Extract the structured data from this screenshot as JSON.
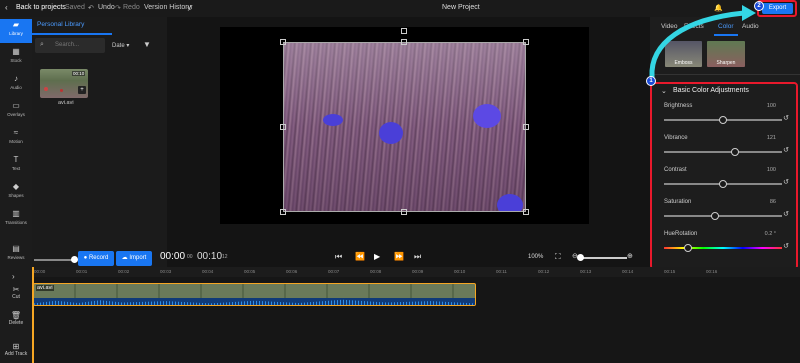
{
  "topbar": {
    "back_label": "Back to projects",
    "saved_label": "Saved",
    "undo_label": "Undo",
    "redo_label": "Redo",
    "history_label": "Version History",
    "title": "New Project",
    "export_label": "Export"
  },
  "rail": {
    "items": [
      {
        "label": "Library",
        "icon": "folder-icon"
      },
      {
        "label": "Stock",
        "icon": "grid-icon"
      },
      {
        "label": "Audio",
        "icon": "music-icon"
      },
      {
        "label": "Overlays",
        "icon": "layers-icon"
      },
      {
        "label": "Motion",
        "icon": "motion-icon"
      },
      {
        "label": "Text",
        "icon": "text-icon"
      },
      {
        "label": "Shapes",
        "icon": "shapes-icon"
      },
      {
        "label": "Transitions",
        "icon": "transition-icon"
      },
      {
        "label": "Reviews",
        "icon": "chat-icon"
      }
    ]
  },
  "library": {
    "tab": "Personal Library",
    "search_placeholder": "Search...",
    "sort_label": "Date",
    "media": [
      {
        "name": "avi.avi",
        "duration": "00:10"
      }
    ]
  },
  "preview": {
    "record_label": "Record",
    "import_label": "Import",
    "current_time": "00:00",
    "current_frames": "00",
    "total_time": "00:10",
    "total_frames": "12",
    "zoom": "100%"
  },
  "rpanel": {
    "tabs": [
      "Video",
      "Effects",
      "Color",
      "Audio"
    ],
    "active_tab": "Color",
    "filters": [
      "Emboss",
      "Sharpen"
    ],
    "section_title": "Basic Color Adjustments",
    "adjustments": [
      {
        "label": "Brightness",
        "value": "100",
        "level": 0.5
      },
      {
        "label": "Vibrance",
        "value": "121",
        "level": 0.6
      },
      {
        "label": "Contrast",
        "value": "100",
        "level": 0.5
      },
      {
        "label": "Saturation",
        "value": "86",
        "level": 0.43
      },
      {
        "label": "HueRotation",
        "value": "0.2 °",
        "level": 0.2
      }
    ],
    "annotations": [
      "1",
      "2"
    ]
  },
  "timeline": {
    "ticks": [
      "00:00",
      "00:01",
      "00:02",
      "00:03",
      "00:04",
      "00:05",
      "00:06",
      "00:07",
      "00:08",
      "00:09",
      "00:10",
      "00:11",
      "00:12",
      "00:13",
      "00:14",
      "00:15",
      "00:16"
    ],
    "clip_name": "avi.avi",
    "tools": [
      {
        "label": "Cut",
        "icon": "scissors-icon"
      },
      {
        "label": "Delete",
        "icon": "trash-icon"
      },
      {
        "label": "Add Track",
        "icon": "add-track-icon"
      }
    ]
  },
  "colors": {
    "accent": "#1976f2",
    "highlight": "#e8192c",
    "arrow": "#34d6e4"
  }
}
